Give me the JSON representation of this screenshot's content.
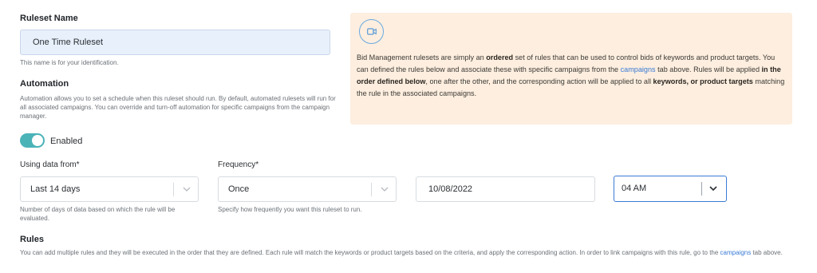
{
  "ruleset": {
    "title": "Ruleset Name",
    "name_value": "One Time Ruleset",
    "name_help": "This name is for your identification."
  },
  "automation": {
    "title": "Automation",
    "help": "Automation allows you to set a schedule when this ruleset should run. By default, automated rulesets will run for all associated campaigns. You can override and turn-off automation for specific campaigns from the campaign manager.",
    "toggle_label": "Enabled",
    "toggle_on": true
  },
  "info": {
    "icon": "video-camera-icon",
    "text_1": "Bid Management rulesets are simply an ",
    "bold_1": "ordered",
    "text_2": " set of rules that can be used to control bids of keywords and product targets. You can defined the rules below and associate these with specific campaigns from the ",
    "link_1": "campaigns",
    "text_3": " tab above. Rules will be applied ",
    "bold_2": "in the order defined below",
    "text_4": ", one after the other, and the corresponding action will be applied to all ",
    "bold_3": "keywords, or product targets",
    "text_5": " matching the rule in the associated campaigns."
  },
  "data_from": {
    "label": "Using data from*",
    "value": "Last 14 days",
    "help": "Number of days of data based on which the rule will be evaluated."
  },
  "frequency": {
    "label": "Frequency*",
    "value": "Once",
    "help": "Specify how frequently you want this ruleset to run."
  },
  "date": {
    "value": "10/08/2022"
  },
  "time": {
    "value": "04 AM"
  },
  "rules": {
    "title": "Rules",
    "text_1": "You can add multiple rules and they will be executed in the order that they are defined. Each rule will match the keywords or product targets based on the criteria, and apply the corresponding action. In order to link campaigns with this rule, go to the ",
    "link": "campaigns",
    "text_2": " tab above."
  },
  "colors": {
    "accent": "#4ab3b8",
    "info_bg": "#fdeedf",
    "link": "#3a7bd5",
    "input_highlight": "#e8f0fb",
    "focus_border": "#3a7bd5"
  }
}
